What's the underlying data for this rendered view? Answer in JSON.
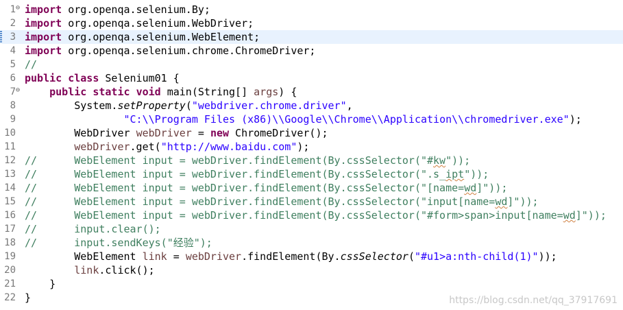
{
  "editor": {
    "current_line": 3,
    "lines": [
      {
        "num": "1",
        "fold": "⊖",
        "text": "import org.openqa.selenium.By;"
      },
      {
        "num": "2",
        "fold": "",
        "text": "import org.openqa.selenium.WebDriver;"
      },
      {
        "num": "3",
        "fold": "",
        "text": "import org.openqa.selenium.WebElement;"
      },
      {
        "num": "4",
        "fold": "",
        "text": "import org.openqa.selenium.chrome.ChromeDriver;"
      },
      {
        "num": "5",
        "fold": "",
        "text": "//"
      },
      {
        "num": "6",
        "fold": "",
        "text": "public class Selenium01 {"
      },
      {
        "num": "7",
        "fold": "⊖",
        "text": "    public static void main(String[] args) {"
      },
      {
        "num": "8",
        "fold": "",
        "text": "        System.setProperty(\"webdriver.chrome.driver\","
      },
      {
        "num": "9",
        "fold": "",
        "text": "                \"C:\\\\Program Files (x86)\\\\Google\\\\Chrome\\\\Application\\\\chromedriver.exe\");"
      },
      {
        "num": "10",
        "fold": "",
        "text": "        WebDriver webDriver = new ChromeDriver();"
      },
      {
        "num": "11",
        "fold": "",
        "text": "        webDriver.get(\"http://www.baidu.com\");"
      },
      {
        "num": "12",
        "fold": "",
        "text": "//      WebElement input = webDriver.findElement(By.cssSelector(\"#kw\"));"
      },
      {
        "num": "13",
        "fold": "",
        "text": "//      WebElement input = webDriver.findElement(By.cssSelector(\".s_ipt\"));"
      },
      {
        "num": "14",
        "fold": "",
        "text": "//      WebElement input = webDriver.findElement(By.cssSelector(\"[name=wd]\"));"
      },
      {
        "num": "15",
        "fold": "",
        "text": "//      WebElement input = webDriver.findElement(By.cssSelector(\"input[name=wd]\"));"
      },
      {
        "num": "16",
        "fold": "",
        "text": "//      WebElement input = webDriver.findElement(By.cssSelector(\"#form>span>input[name=wd]\"));"
      },
      {
        "num": "17",
        "fold": "",
        "text": "//      input.clear();"
      },
      {
        "num": "18",
        "fold": "",
        "text": "//      input.sendKeys(\"经验\");"
      },
      {
        "num": "19",
        "fold": "",
        "text": "        WebElement link = webDriver.findElement(By.cssSelector(\"#u1>a:nth-child(1)\"));"
      },
      {
        "num": "20",
        "fold": "",
        "text": "        link.click();"
      },
      {
        "num": "21",
        "fold": "",
        "text": "    }"
      },
      {
        "num": "22",
        "fold": "",
        "text": "}"
      }
    ]
  },
  "watermark": "https://blog.csdn.net/qq_37917691",
  "colors": {
    "keyword": "#7f0055",
    "comment": "#3f7f5f",
    "string": "#2a00ff",
    "local_variable": "#6a3e3e",
    "current_line_bg": "#e8f2fe"
  }
}
